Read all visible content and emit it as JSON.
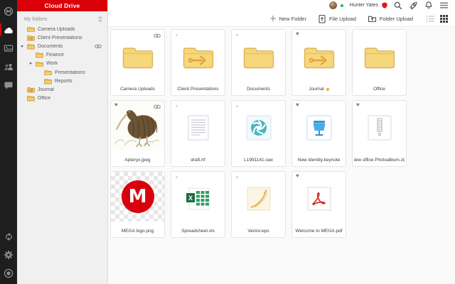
{
  "header": {
    "title": "Cloud Drive"
  },
  "topbar": {
    "username": "Hunter Yates",
    "presence": "online",
    "icons": [
      "avatar",
      "presence-dot",
      "account-badge",
      "search",
      "rocket",
      "notifications",
      "menu"
    ]
  },
  "toolbar": {
    "new_folder_label": "New Folder",
    "file_upload_label": "File Upload",
    "folder_upload_label": "Folder Upload",
    "view_modes": [
      "list",
      "grid"
    ],
    "active_view": "grid"
  },
  "tree": {
    "header": "My folders",
    "items": [
      {
        "label": "Camera Uploads",
        "level": 1,
        "icon": "folder"
      },
      {
        "label": "Client Presentations",
        "level": 1,
        "icon": "folder-shared"
      },
      {
        "label": "Documents",
        "level": 1,
        "icon": "folder",
        "expanded": true,
        "linked": true
      },
      {
        "label": "Finance",
        "level": 2,
        "icon": "folder"
      },
      {
        "label": "Work",
        "level": 2,
        "icon": "folder",
        "expanded": true
      },
      {
        "label": "Presentations",
        "level": 3,
        "icon": "folder"
      },
      {
        "label": "Reports",
        "level": 3,
        "icon": "folder"
      },
      {
        "label": "Journal",
        "level": 1,
        "icon": "folder-shared"
      },
      {
        "label": "Office",
        "level": 1,
        "icon": "folder"
      }
    ]
  },
  "rail": {
    "items": [
      "mega-logo",
      "cloud-drive",
      "media",
      "contacts",
      "chat"
    ],
    "bottom_items": [
      "sync",
      "settings",
      "app-badge"
    ],
    "active_item": "cloud-drive"
  },
  "grid": {
    "items": [
      {
        "label": "Camera Uploads",
        "type": "folder",
        "linked": true
      },
      {
        "label": "Client Presentations",
        "type": "folder-shared"
      },
      {
        "label": "Documents",
        "type": "folder"
      },
      {
        "label": "Journal",
        "type": "folder-shared",
        "favorite": true,
        "label_color": "#f7a32b"
      },
      {
        "label": "Office",
        "type": "folder"
      },
      {
        "label": "Apteryx.jpeg",
        "type": "image-thumbnail",
        "favorite": true,
        "linked": true
      },
      {
        "label": "draft.rtf",
        "type": "rtf"
      },
      {
        "label": "L1991141.raw",
        "type": "raw"
      },
      {
        "label": "New identity.keynote",
        "type": "keynote",
        "favorite": true
      },
      {
        "label": "New office Photoalbum.zip",
        "type": "zip",
        "favorite": true
      },
      {
        "label": "MEGA logo.png",
        "type": "png-transparent"
      },
      {
        "label": "Spreadsheet.xls",
        "type": "xls"
      },
      {
        "label": "Vector.eps",
        "type": "eps"
      },
      {
        "label": "Welcome to MEGA.pdf",
        "type": "pdf",
        "favorite": true
      }
    ]
  },
  "colors": {
    "brand_red": "#d90008",
    "rail_bg": "#1e1e1e",
    "panel_bg": "#f0f0f0",
    "folder_yellow": "#f6d77b",
    "share_arrow_orange": "#e2a237",
    "favorite_grey": "#7d7d7d",
    "label_orange": "#f7a32b",
    "presence_green": "#1fbc56"
  }
}
